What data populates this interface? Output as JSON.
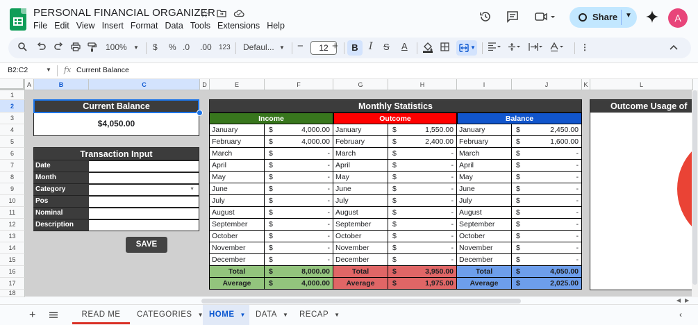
{
  "app": {
    "doc_title": "PERSONAL FINANCIAL ORGANIZER",
    "menu": [
      "File",
      "Edit",
      "View",
      "Insert",
      "Format",
      "Data",
      "Tools",
      "Extensions",
      "Help"
    ],
    "share_label": "Share",
    "avatar_letter": "A"
  },
  "toolbar": {
    "zoom": "100%",
    "currency": "$",
    "percent": "%",
    "dec_decrease": ".0",
    "dec_increase": ".00",
    "num_format": "123",
    "font_name": "Defaul...",
    "font_size": "12",
    "bold": "B",
    "italic": "I",
    "strike": "S",
    "text_color": "A"
  },
  "formula_bar": {
    "name_box": "B2:C2",
    "fx": "fx",
    "content": "Current Balance"
  },
  "columns": [
    "A",
    "B",
    "C",
    "D",
    "E",
    "F",
    "G",
    "H",
    "I",
    "J",
    "K",
    "L"
  ],
  "rows": [
    "1",
    "2",
    "3",
    "4",
    "5",
    "6",
    "7",
    "8",
    "9",
    "10",
    "11",
    "12",
    "13",
    "14",
    "15",
    "16",
    "17",
    "18"
  ],
  "current_balance": {
    "title": "Current Balance",
    "value": "$4,050.00"
  },
  "transaction_input": {
    "title": "Transaction Input",
    "fields": [
      "Date",
      "Month",
      "Category",
      "Pos",
      "Nominal",
      "Description"
    ],
    "save_label": "SAVE"
  },
  "monthly_stats": {
    "title": "Monthly Statistics",
    "headers": {
      "income": "Income",
      "outcome": "Outcome",
      "balance": "Balance"
    },
    "colors": {
      "income": "#38761d",
      "outcome": "#ff0000",
      "balance": "#1155cc",
      "income_total": "#93c47d",
      "outcome_total": "#e06666",
      "balance_total": "#6d9eeb"
    },
    "currency": "$",
    "months": [
      "January",
      "February",
      "March",
      "April",
      "May",
      "June",
      "July",
      "August",
      "September",
      "October",
      "November",
      "December"
    ],
    "income": [
      "4,000.00",
      "4,000.00",
      "-",
      "-",
      "-",
      "-",
      "-",
      "-",
      "-",
      "-",
      "-",
      "-"
    ],
    "outcome": [
      "1,550.00",
      "2,400.00",
      "-",
      "-",
      "-",
      "-",
      "-",
      "-",
      "-",
      "-",
      "-",
      "-"
    ],
    "balance": [
      "2,450.00",
      "1,600.00",
      "-",
      "-",
      "-",
      "-",
      "-",
      "-",
      "-",
      "-",
      "-",
      "-"
    ],
    "total_label": "Total",
    "average_label": "Average",
    "income_total": "8,000.00",
    "income_average": "4,000.00",
    "outcome_total": "3,950.00",
    "outcome_average": "1,975.00",
    "balance_total": "4,050.00",
    "balance_average": "2,025.00"
  },
  "outcome_usage": {
    "title": "Outcome Usage of"
  },
  "sheet_tabs": [
    {
      "label": "READ ME"
    },
    {
      "label": "CATEGORIES"
    },
    {
      "label": "HOME"
    },
    {
      "label": "DATA"
    },
    {
      "label": "RECAP"
    }
  ]
}
